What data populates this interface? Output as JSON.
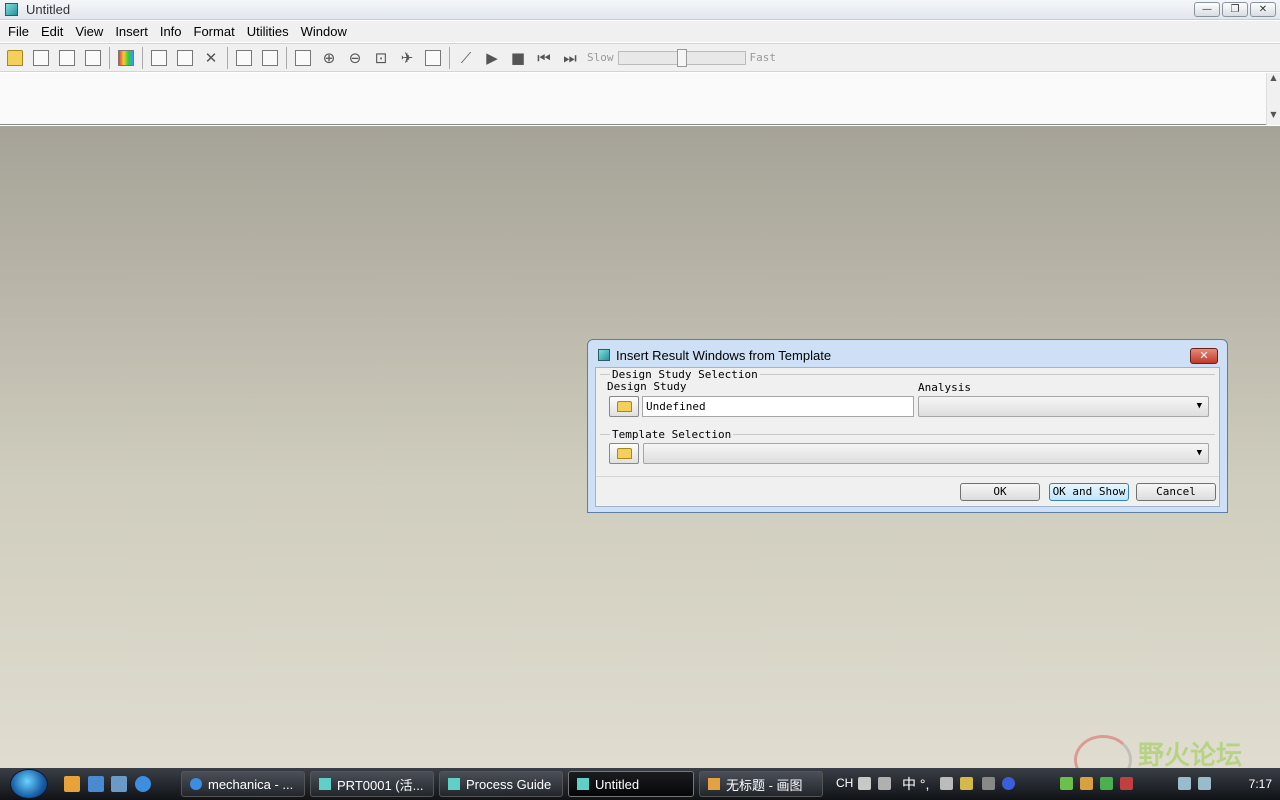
{
  "window": {
    "title": "Untitled",
    "minimize": "—",
    "restore": "❐",
    "close": "✕"
  },
  "menu": [
    "File",
    "Edit",
    "View",
    "Insert",
    "Info",
    "Format",
    "Utilities",
    "Window"
  ],
  "toolbar": {
    "slow_label": "Slow",
    "fast_label": "Fast",
    "animation_speed_fraction": 0.5
  },
  "dialog": {
    "title": "Insert Result Windows from Template",
    "close": "✕",
    "design_study_group": "Design Study Selection",
    "design_study_label": "Design Study",
    "design_study_value": "Undefined",
    "analysis_label": "Analysis",
    "analysis_value": "",
    "template_group": "Template Selection",
    "template_value": "",
    "ok": "OK",
    "ok_and_show": "OK and Show",
    "cancel": "Cancel"
  },
  "taskbar": {
    "tasks": [
      "mechanica - ...",
      "PRT0001 (活...",
      "Process Guide",
      "Untitled",
      "无标题 - 画图"
    ],
    "active_task": "Untitled",
    "lang": "CH",
    "ime": "中 °,",
    "clock": "7:17"
  },
  "watermark": {
    "text": "野火论坛"
  },
  "colors": {
    "dialog_frame": "#cde0f5",
    "workspace_top": "#a5a297",
    "workspace_bottom": "#e0ddd0",
    "taskbar": "#1c1f24"
  }
}
